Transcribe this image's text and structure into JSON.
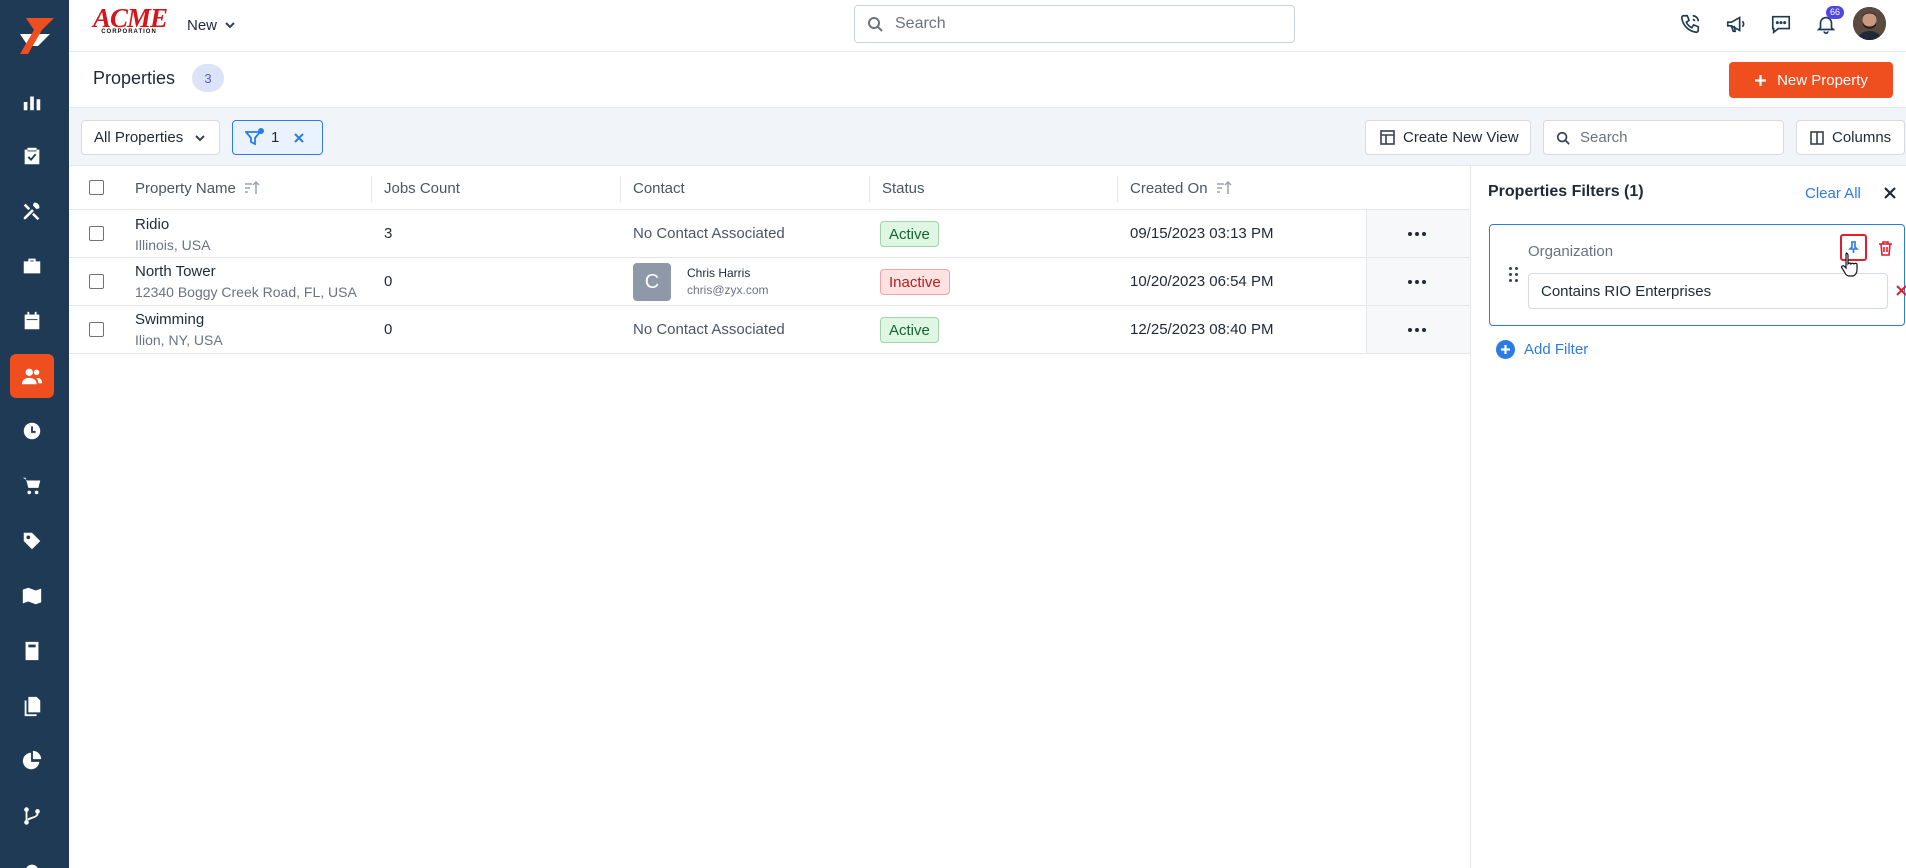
{
  "app": {
    "brand_main": "ACME",
    "brand_sub": "CORPORATION",
    "new_label": "New",
    "search_placeholder": "Search",
    "notifications_count": "66"
  },
  "sidebar": {
    "items": [
      {
        "icon": "bar-chart-icon"
      },
      {
        "icon": "clipboard-check-icon"
      },
      {
        "icon": "tools-icon"
      },
      {
        "icon": "briefcase-icon"
      },
      {
        "icon": "calendar-icon"
      },
      {
        "icon": "users-icon",
        "active": true
      },
      {
        "icon": "clock-icon"
      },
      {
        "icon": "cart-icon"
      },
      {
        "icon": "tag-icon"
      },
      {
        "icon": "map-icon"
      },
      {
        "icon": "calculator-icon"
      },
      {
        "icon": "documents-icon"
      },
      {
        "icon": "pie-chart-icon"
      },
      {
        "icon": "git-branch-icon"
      }
    ]
  },
  "page": {
    "title": "Properties",
    "count": "3",
    "new_button": "New Property"
  },
  "toolbar": {
    "view_select": "All Properties",
    "filter_count": "1",
    "create_view": "Create New View",
    "search_placeholder": "Search",
    "columns": "Columns"
  },
  "table": {
    "headers": {
      "property_name": "Property Name",
      "jobs_count": "Jobs Count",
      "contact": "Contact",
      "status": "Status",
      "created_on": "Created On"
    },
    "rows": [
      {
        "name": "Ridio",
        "address": "Illinois, USA",
        "jobs": "3",
        "contact": "No Contact Associated",
        "status": "Active",
        "created": "09/15/2023 03:13 PM"
      },
      {
        "name": "North Tower",
        "address": "12340 Boggy Creek Road, FL, USA",
        "jobs": "0",
        "contact_initial": "C",
        "contact_name": "Chris Harris",
        "contact_email": "chris@zyx.com",
        "status": "Inactive",
        "created": "10/20/2023 06:54 PM"
      },
      {
        "name": "Swimming",
        "address": "Ilion, NY, USA",
        "jobs": "0",
        "contact": "No Contact Associated",
        "status": "Active",
        "created": "12/25/2023 08:40 PM"
      }
    ]
  },
  "filters": {
    "title": "Properties Filters (1)",
    "clear_all": "Clear All",
    "items": [
      {
        "label": "Organization",
        "value": "Contains RIO Enterprises"
      }
    ],
    "add_filter": "Add Filter"
  },
  "colors": {
    "sidebar": "#1e3a55",
    "accent": "#ef4f1f",
    "link": "#2c7be5",
    "active_status": "#166534",
    "inactive_status": "#b91c1c"
  }
}
